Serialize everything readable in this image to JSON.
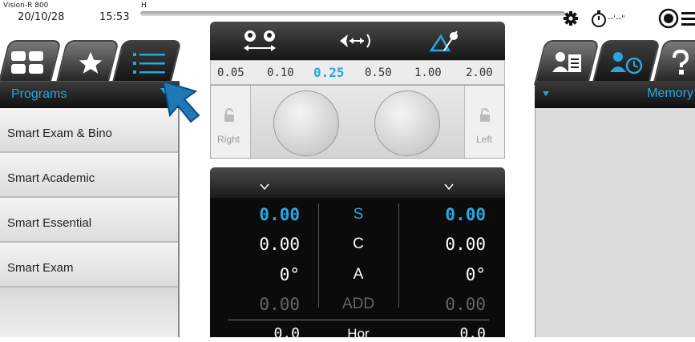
{
  "status": {
    "device": "Vision-R 800",
    "flag": "H",
    "date": "20/10/28",
    "time": "15:53",
    "timer": "--'--\""
  },
  "left_panel": {
    "tabs": [
      {
        "icon": "grid-icon",
        "active": false
      },
      {
        "icon": "star-icon",
        "active": false
      },
      {
        "icon": "list-icon",
        "active": true
      }
    ],
    "header": "Programs",
    "programs": [
      "Smart Exam & Bino",
      "Smart Academic",
      "Smart Essential",
      "Smart Exam"
    ]
  },
  "center": {
    "mode_icons": [
      "eyes-separation-icon",
      "distance-icon",
      "scenery-icon"
    ],
    "acuity_values": [
      "0.05",
      "0.10",
      "0.25",
      "0.50",
      "1.00",
      "2.00"
    ],
    "acuity_selected": "0.25",
    "right_label": "Right",
    "left_label": "Left",
    "rows": [
      {
        "label": "S",
        "right": "0.00",
        "left": "0.00",
        "style": "blue"
      },
      {
        "label": "C",
        "right": "0.00",
        "left": "0.00",
        "style": "white"
      },
      {
        "label": "A",
        "right": "0°",
        "left": "0°",
        "style": "white"
      },
      {
        "label": "ADD",
        "right": "0.00",
        "left": "0.00",
        "style": "gray"
      },
      {
        "label": "Hor",
        "right": "0.0",
        "left": "0.0",
        "style": "white"
      }
    ]
  },
  "right_panel": {
    "tabs": [
      {
        "icon": "patient-record-icon",
        "active": false
      },
      {
        "icon": "patient-history-icon",
        "active": true
      },
      {
        "icon": "help-icon",
        "active": false
      }
    ],
    "header": "Memory"
  },
  "colors": {
    "accent": "#2aa6e0",
    "dark": "#111111"
  }
}
